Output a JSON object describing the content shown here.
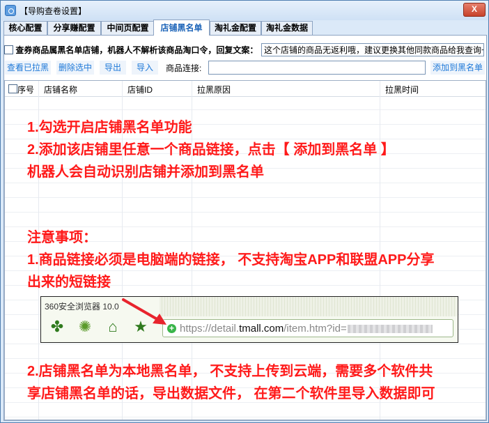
{
  "window": {
    "title": "【导购查卷设置】",
    "close_label": "X"
  },
  "tabs": [
    {
      "label": "核心配置"
    },
    {
      "label": "分享赚配置"
    },
    {
      "label": "中间页配置"
    },
    {
      "label": "店铺黑名单"
    },
    {
      "label": "淘礼金配置"
    },
    {
      "label": "淘礼金数据"
    }
  ],
  "active_tab": "店铺黑名单",
  "blacklist_option": {
    "label": "查券商品属黑名单店铺，机器人不解析该商品淘口令，回复文案：",
    "checked": false,
    "reply_text": "这个店铺的商品无返利哦，建议更换其他同款商品给我查询~"
  },
  "toolbar": {
    "view_button": "查看已拉黑",
    "delete_button": "删除选中",
    "export_button": "导出",
    "import_button": "导入",
    "link_label": "商品连接:",
    "link_value": "",
    "add_button": "添加到黑名单"
  },
  "table": {
    "columns": [
      "序号",
      "店铺名称",
      "店铺ID",
      "拉黑原因",
      "拉黑时间"
    ],
    "rows": []
  },
  "instructions": {
    "line1": "1.勾选开启店铺黑名单功能",
    "line2": "2.添加该店铺里任意一个商品链接，点击【 添加到黑名单 】",
    "line3": "机器人会自动识别店铺并添加到黑名单",
    "note_title": "注意事项：",
    "note1_a": "1.商品链接必须是电脑端的链接，  不支持淘宝APP和联盟APP分享",
    "note1_b": "出来的短链接",
    "note2_a": "2.店铺黑名单为本地黑名单，  不支持上传到云端，需要多个软件共",
    "note2_b": "享店铺黑名单的话，导出数据文件，  在第二个软件里导入数据即可"
  },
  "browser_example": {
    "browser_name": "360安全浏览器 10.0",
    "url_prefix": "https://detail.",
    "url_domain": "tmall.com",
    "url_suffix": "/item.htm?id=",
    "icons": [
      "leaf-icon",
      "sun-icon",
      "home-icon",
      "star-icon"
    ],
    "arrow_color": "#e8242d"
  },
  "colors": {
    "accent": "#1e78d8",
    "instruction_red": "#ff1a1a"
  }
}
